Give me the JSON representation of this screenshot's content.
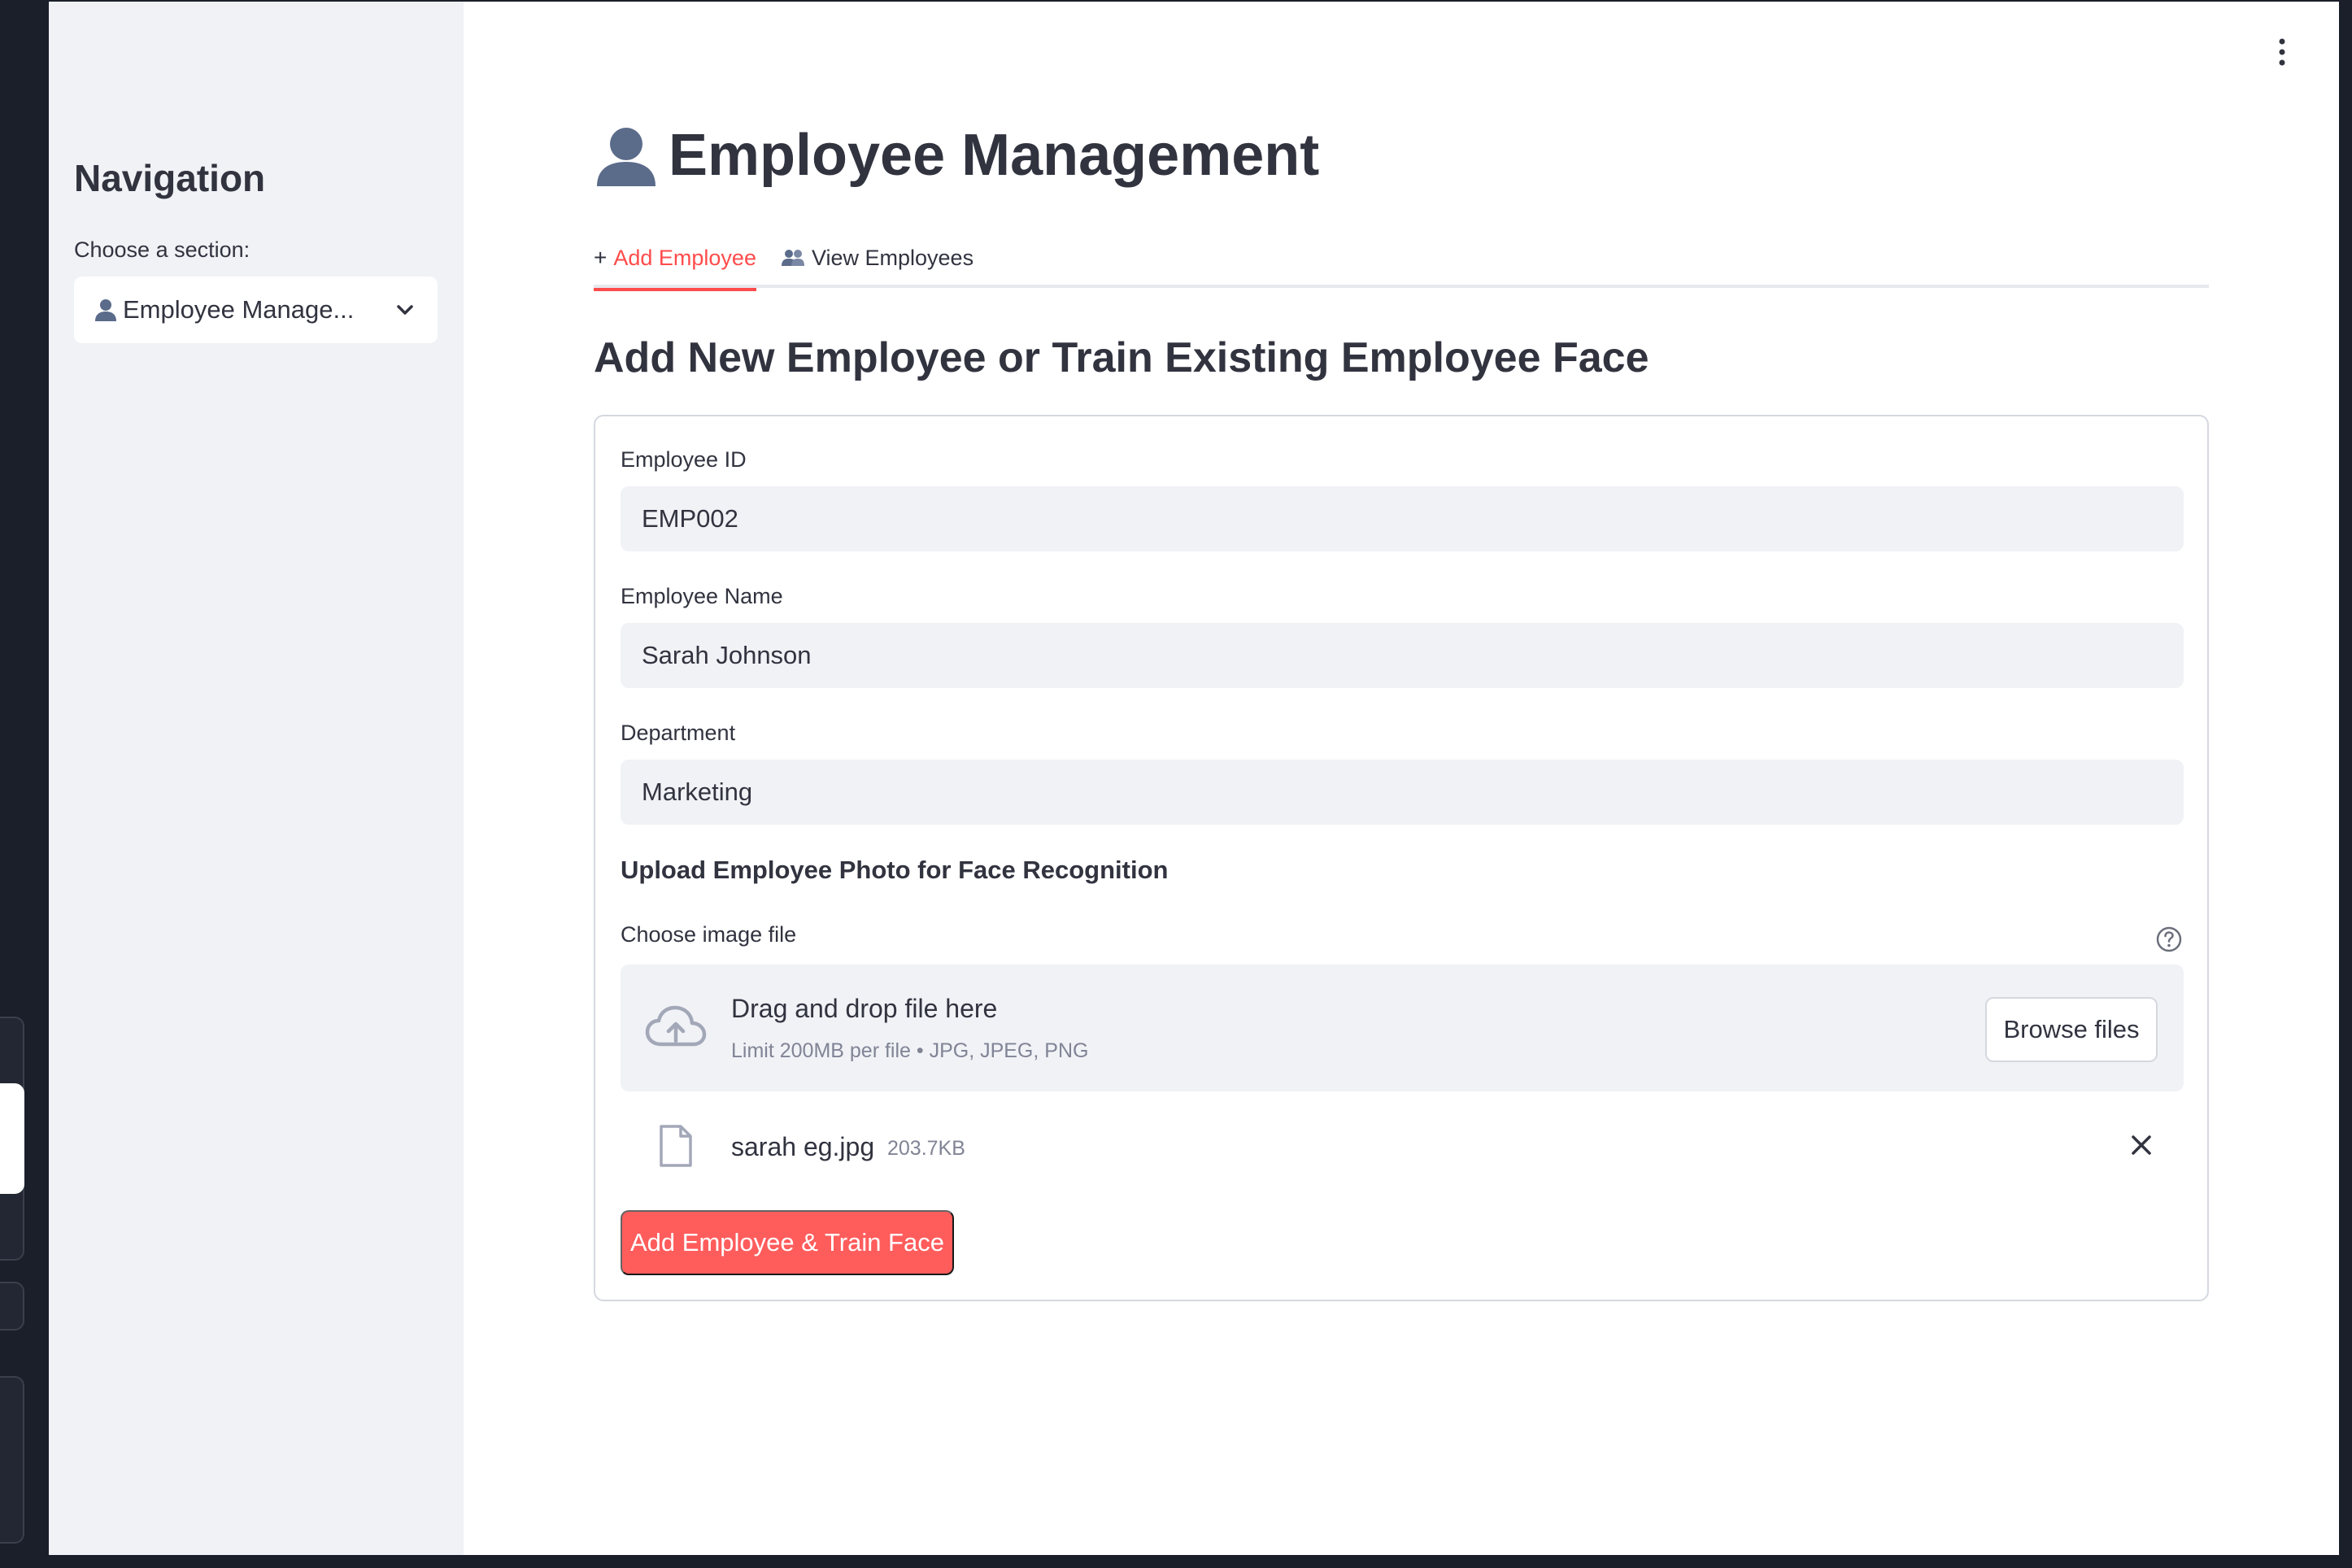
{
  "sidebar": {
    "title": "Navigation",
    "choose_label": "Choose a section:",
    "selected_section": "Employee Manage..."
  },
  "header": {
    "title": "Employee Management"
  },
  "tabs": [
    {
      "label": "Add Employee",
      "icon": "plus-icon",
      "active": true
    },
    {
      "label": "View Employees",
      "icon": "people-icon",
      "active": false
    }
  ],
  "form": {
    "section_title": "Add New Employee or Train Existing Employee Face",
    "employee_id": {
      "label": "Employee ID",
      "value": "EMP002"
    },
    "employee_name": {
      "label": "Employee Name",
      "value": "Sarah Johnson"
    },
    "department": {
      "label": "Department",
      "value": "Marketing"
    },
    "upload_heading": "Upload Employee Photo for Face Recognition",
    "file_label": "Choose image file",
    "dropzone": {
      "main_text": "Drag and drop file here",
      "limit_text": "Limit 200MB per file • JPG, JPEG, PNG",
      "browse_label": "Browse files"
    },
    "uploaded_file": {
      "name": "sarah eg.jpg",
      "size": "203.7KB"
    },
    "submit_label": "Add Employee & Train Face"
  },
  "colors": {
    "accent": "#ff4b4b",
    "sidebar_bg": "#f0f2f6",
    "text": "#31333f"
  }
}
